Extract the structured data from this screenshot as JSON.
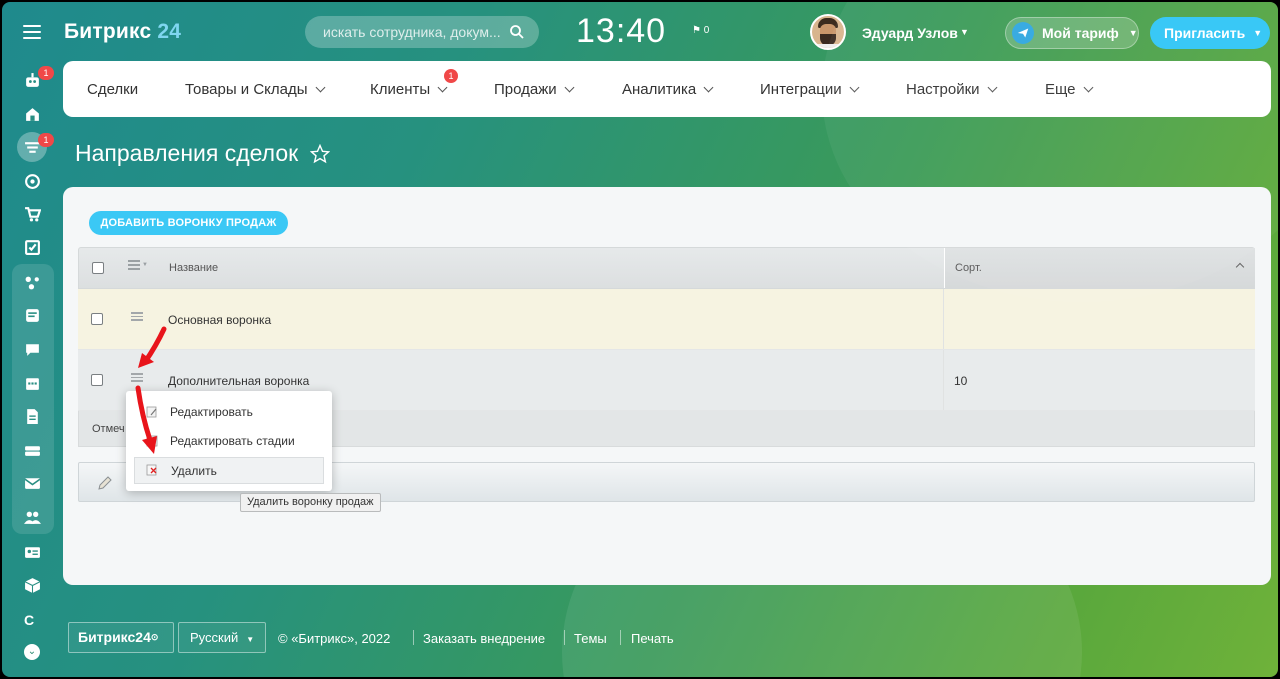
{
  "header": {
    "logo_text": "Битрикс",
    "logo_num": "24",
    "search_placeholder": "искать сотрудника, докум...",
    "clock": "13:40",
    "flag_count": "0",
    "user_name": "Эдуард Узлов",
    "tariff_label": "Мой тариф",
    "invite_label": "Пригласить"
  },
  "sidebar": {
    "badges": [
      "1",
      "1"
    ],
    "bottom_letter": "C"
  },
  "menu": {
    "items": [
      {
        "label": "Сделки"
      },
      {
        "label": "Товары и Склады"
      },
      {
        "label": "Клиенты"
      },
      {
        "label": "Продажи"
      },
      {
        "label": "Аналитика"
      },
      {
        "label": "Интеграции"
      },
      {
        "label": "Настройки"
      },
      {
        "label": "Еще"
      }
    ],
    "clients_badge": "1"
  },
  "page": {
    "title": "Направления сделок"
  },
  "panel": {
    "add_button": "ДОБАВИТЬ ВОРОНКУ ПРОДАЖ",
    "columns": {
      "name": "Название",
      "sort": "Сорт."
    },
    "rows": [
      {
        "name": "Основная воронка",
        "sort": ""
      },
      {
        "name": "Дополнительная воронка",
        "sort": "10"
      }
    ],
    "footer_text": "Отмеч"
  },
  "popup": {
    "items": [
      {
        "label": "Редактировать"
      },
      {
        "label": "Редактировать стадии"
      },
      {
        "label": "Удалить"
      }
    ],
    "tooltip": "Удалить воронку продаж"
  },
  "footer": {
    "logo": "Битрикс24",
    "language": "Русский",
    "copyright": "© «Битрикс», 2022",
    "links": [
      "Заказать внедрение",
      "Темы",
      "Печать"
    ]
  },
  "colors": {
    "accent": "#2fc6f6",
    "badge": "#f04848",
    "arrow": "#e8141b"
  }
}
